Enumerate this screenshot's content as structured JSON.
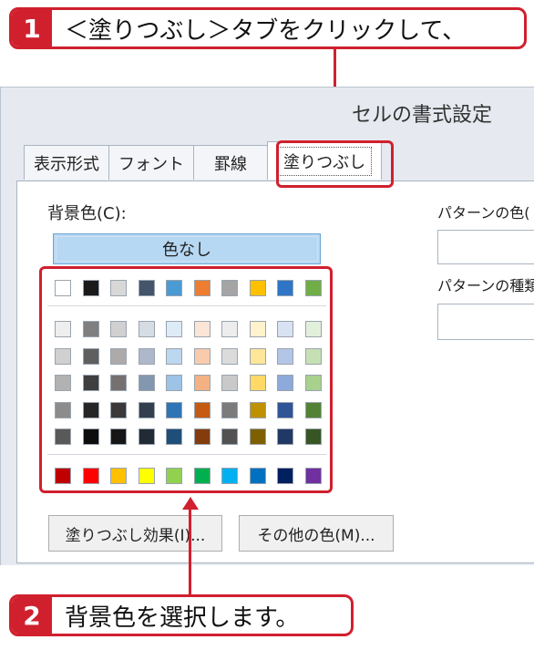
{
  "callouts": {
    "step1": {
      "number": "1",
      "text": "＜塗りつぶし＞タブをクリックして、"
    },
    "step2": {
      "number": "2",
      "text": "背景色を選択します。"
    }
  },
  "dialog": {
    "title": "セルの書式設定",
    "tabs": [
      "表示形式",
      "フォント",
      "罫線",
      "塗りつぶし"
    ],
    "active_tab": "塗りつぶし",
    "background_color_label": "背景色(C):",
    "no_color_button": "色なし",
    "pattern_color_label": "パターンの色(",
    "pattern_type_label": "パターンの種類",
    "fill_effects_button": "塗りつぶし効果(I)...",
    "more_colors_button": "その他の色(M)..."
  },
  "palette": {
    "top_row": [
      "#ffffff",
      "#1a1a1a",
      "#d8d8d8",
      "#44546a",
      "#4a9ad4",
      "#ed7d31",
      "#a5a5a5",
      "#ffc000",
      "#2e75c6",
      "#70ad47"
    ],
    "tint_rows": [
      [
        "#eeeeee",
        "#7f7f7f",
        "#d0d0d0",
        "#d6dce4",
        "#ddebf7",
        "#fbe5d6",
        "#ededed",
        "#fff2cc",
        "#d9e2f3",
        "#e2efda"
      ],
      [
        "#d0d0d0",
        "#5f5f5f",
        "#aeaaaa",
        "#adb9ca",
        "#bdd7ee",
        "#f8cbad",
        "#dbdbdb",
        "#ffe699",
        "#b4c6e7",
        "#c6e0b4"
      ],
      [
        "#b2b2b2",
        "#3f3f3f",
        "#757171",
        "#8497b0",
        "#9dc3e6",
        "#f4b183",
        "#c9c9c9",
        "#ffd966",
        "#8eaadb",
        "#a9d18e"
      ],
      [
        "#8c8c8c",
        "#262626",
        "#3a3838",
        "#333f4f",
        "#2e75b6",
        "#c55a11",
        "#7b7b7b",
        "#bf9000",
        "#2f5597",
        "#548235"
      ],
      [
        "#595959",
        "#0d0d0d",
        "#171616",
        "#222a35",
        "#1f4e79",
        "#843c0c",
        "#525252",
        "#7f6000",
        "#203864",
        "#375623"
      ]
    ],
    "standard_row": [
      "#c00000",
      "#ff0000",
      "#ffc000",
      "#ffff00",
      "#92d050",
      "#00b050",
      "#00b0f0",
      "#0070c0",
      "#002060",
      "#7030a0"
    ]
  },
  "colors": {
    "accent_red": "#d0202e",
    "selected_button_fill": "#b7d8f3"
  }
}
